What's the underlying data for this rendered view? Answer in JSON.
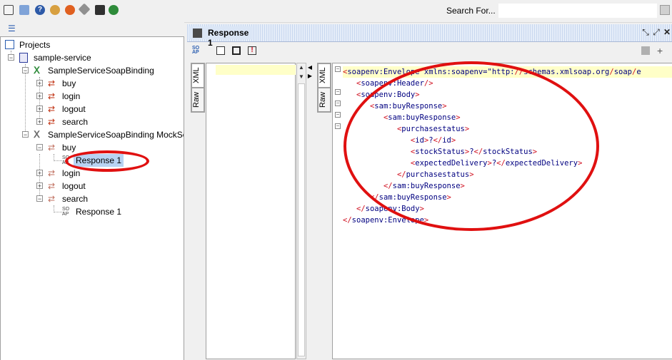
{
  "toolbar": {
    "icons": [
      "save-all-icon",
      "copy-icon",
      "help-icon",
      "users-icon",
      "refresh-icon",
      "tools-icon",
      "tag-icon",
      "globe-icon"
    ],
    "search_label": "Search For...",
    "search_placeholder": ""
  },
  "navigator": {
    "root_label": "Projects",
    "project_label": "sample-service",
    "binding_label": "SampleServiceSoapBinding",
    "binding_ops": [
      "buy",
      "login",
      "logout",
      "search"
    ],
    "mock_label": "SampleServiceSoapBinding MockSe",
    "mock_ops": {
      "buy": "buy",
      "buy_response": "Response 1",
      "login": "login",
      "logout": "logout",
      "search": "search",
      "search_response": "Response 1"
    }
  },
  "editor": {
    "title": "Response 1",
    "left_tabs": [
      "XML",
      "Raw"
    ],
    "right_tabs": [
      "XML",
      "Raw"
    ],
    "xml_lines": [
      "<soapenv:Envelope xmlns:soapenv=\"http://schemas.xmlsoap.org/soap/e",
      "   <soapenv:Header/>",
      "   <soapenv:Body>",
      "      <sam:buyResponse>",
      "         <sam:buyResponse>",
      "            <purchasestatus>",
      "               <id>?</id>",
      "               <stockStatus>?</stockStatus>",
      "               <expectedDelivery>?</expectedDelivery>",
      "            </purchasestatus>",
      "         </sam:buyResponse>",
      "      </sam:buyResponse>",
      "   </soapenv:Body>",
      "</soapenv:Envelope>"
    ]
  },
  "colors": {
    "annotation": "#e01010",
    "selection": "#b8d3f3",
    "xml_tag": "#000080",
    "xml_bracket": "#d01020",
    "current_line": "#ffffc8"
  }
}
